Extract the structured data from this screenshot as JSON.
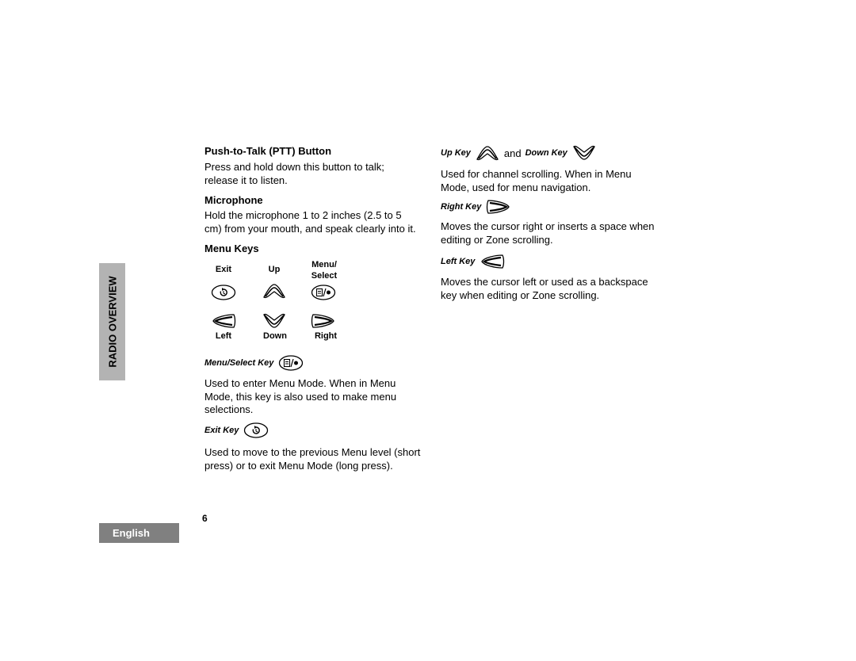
{
  "side_tab": {
    "label": "RADIO OVERVIEW"
  },
  "language_tab": {
    "label": "English"
  },
  "page_number": "6",
  "left_column": {
    "ptt": {
      "heading": "Push-to-Talk (PTT) Button",
      "lines": [
        "Press and hold down this button to talk;",
        "release it to listen."
      ]
    },
    "microphone": {
      "heading": "Microphone",
      "lines": [
        "Hold the microphone 1 to 2 inches (2.5 to 5",
        "cm) from your mouth, and speak clearly into it."
      ]
    },
    "menu_keys": {
      "heading": "Menu Keys",
      "labels": {
        "exit": "Exit",
        "up": "Up",
        "menu_select_1": "Menu/",
        "menu_select_2": "Select",
        "left": "Left",
        "down": "Down",
        "right": "Right"
      },
      "icons": [
        "exit-key-icon",
        "up-key-icon",
        "menu-select-key-icon",
        "left-key-icon",
        "down-key-icon",
        "right-key-icon"
      ]
    },
    "menu_select_key": {
      "heading": "Menu/Select Key",
      "lines": [
        "Used to enter Menu Mode. When in Menu",
        "Mode, this key is also used to make menu",
        "selections."
      ]
    },
    "exit_key": {
      "heading": "Exit Key",
      "lines": [
        "Used to move to the previous Menu level (short",
        "press) or to exit Menu Mode (long press)."
      ]
    }
  },
  "right_column": {
    "up_down": {
      "heading_up": "Up Key",
      "connector": "and",
      "heading_down": "Down Key",
      "lines": [
        "Used for channel scrolling. When in Menu",
        "Mode, used for menu navigation."
      ]
    },
    "right_key": {
      "heading": "Right Key",
      "lines": [
        "Moves the cursor right or inserts a space when",
        "editing or Zone scrolling."
      ]
    },
    "left_key": {
      "heading": "Left Key",
      "lines": [
        "Moves the cursor left or used as a backspace",
        "key when editing or Zone scrolling."
      ]
    }
  }
}
